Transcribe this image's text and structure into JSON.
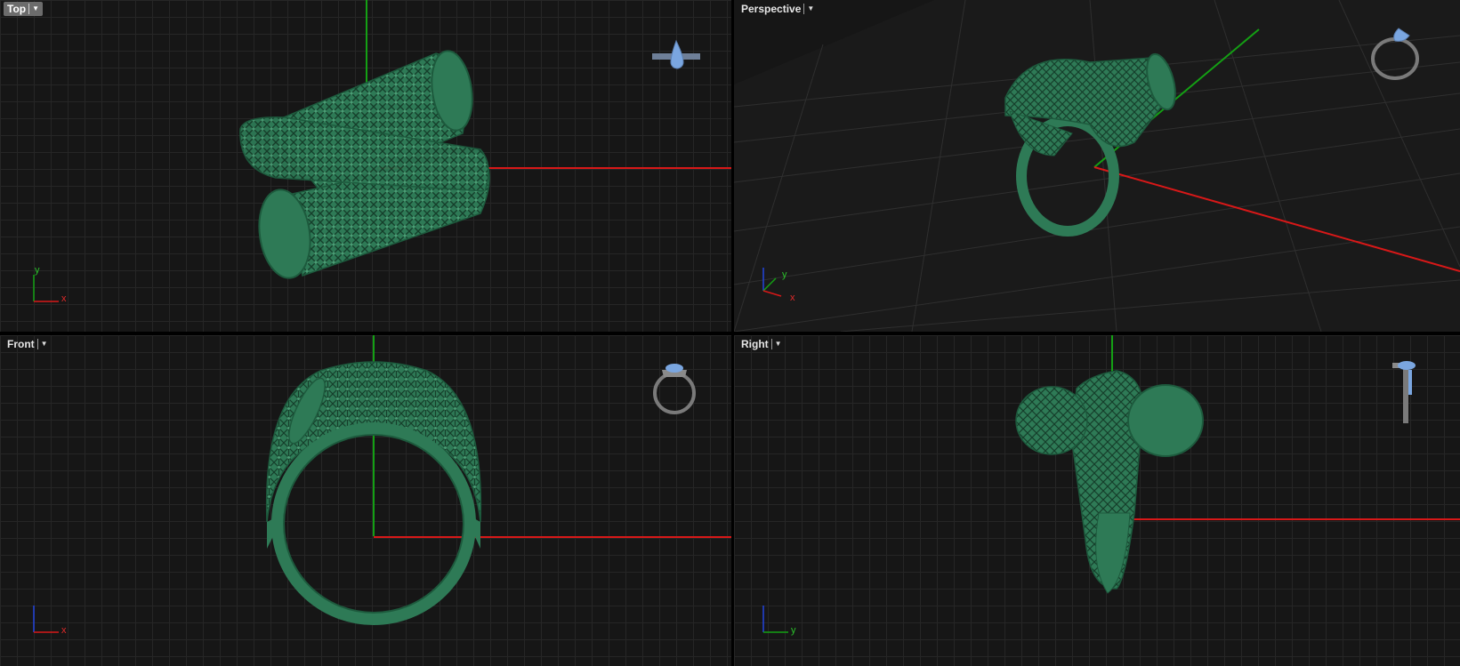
{
  "viewports": {
    "top": {
      "label": "Top",
      "active": true
    },
    "perspective": {
      "label": "Perspective",
      "active": false
    },
    "front": {
      "label": "Front",
      "active": false
    },
    "right": {
      "label": "Right",
      "active": false
    }
  },
  "axis_labels": {
    "x": "x",
    "y": "y"
  },
  "colors": {
    "model": "#2e7a56",
    "model_dark": "#1d5a3d",
    "model_light": "#4a9c74",
    "gem": "#7aa6e0",
    "axis_x": "#d81818",
    "axis_y": "#14a014",
    "axis_z": "#2244dd",
    "background": "#161616",
    "grid": "#262626"
  },
  "icons": {
    "dropdown": "dropdown-arrow-icon",
    "preview": "ring-preview-icon",
    "gizmo": "axis-gizmo-icon"
  }
}
